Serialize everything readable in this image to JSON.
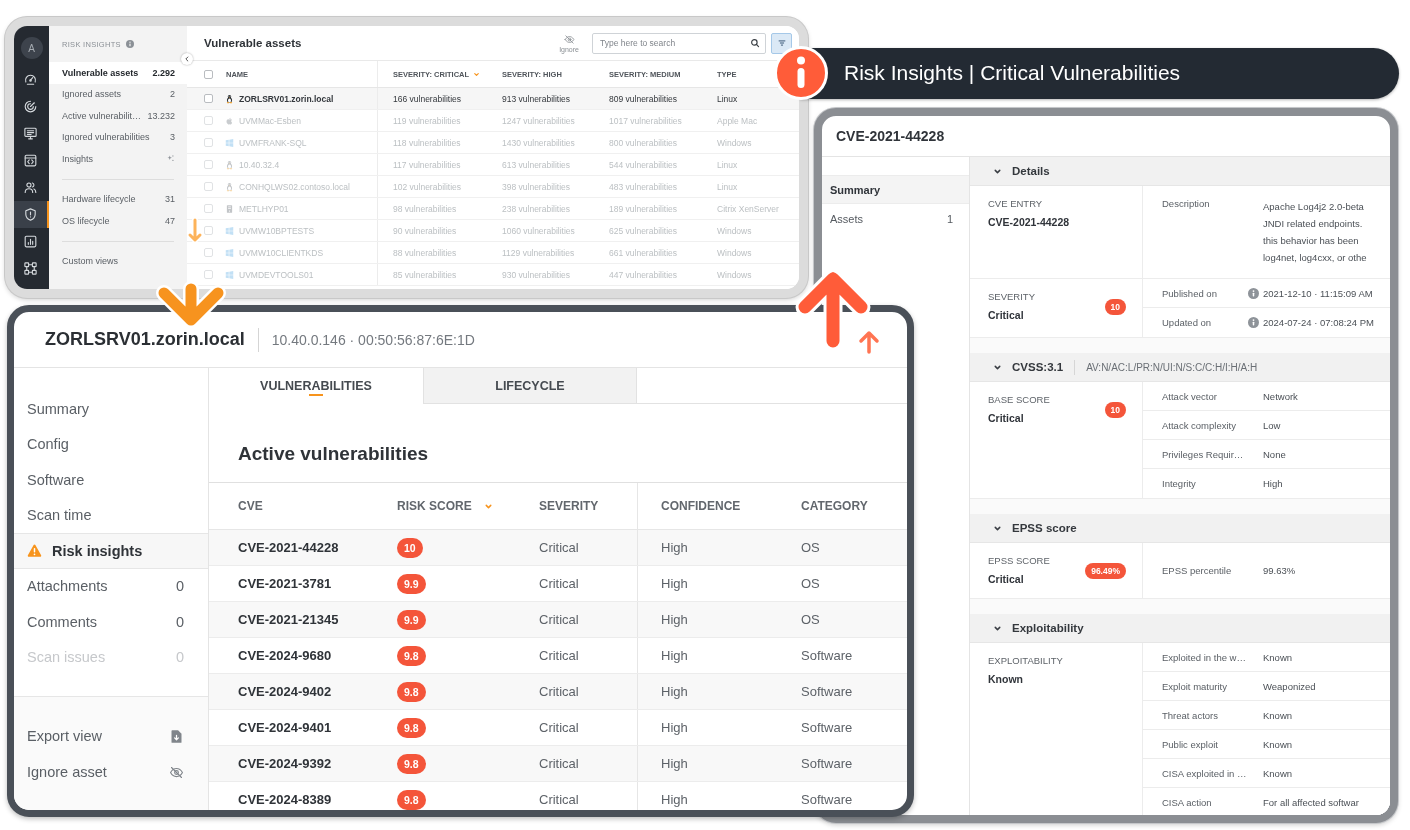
{
  "assets_window": {
    "rail": {
      "avatar": "A",
      "items": [
        {
          "selected": false
        },
        {
          "selected": false
        },
        {
          "selected": false
        },
        {
          "selected": false
        },
        {
          "selected": false
        },
        {
          "selected": true
        },
        {
          "selected": false
        },
        {
          "selected": false
        }
      ]
    },
    "sidebar": {
      "title": "RISK INSIGHTS",
      "sections": [
        {
          "items": [
            {
              "kind": "count",
              "label": "Vulnerable assets",
              "count": "2.292",
              "selected": true
            },
            {
              "kind": "count",
              "label": "Ignored assets",
              "count": "2",
              "selected": false
            },
            {
              "kind": "count",
              "label": "Active vulnerabilit…",
              "count": "13.232",
              "selected": false
            },
            {
              "kind": "count",
              "label": "Ignored vulnerabilities",
              "count": "3",
              "selected": false
            },
            {
              "kind": "indicator",
              "label": "Insights",
              "selected": false
            }
          ]
        },
        {
          "items": [
            {
              "kind": "count",
              "label": "Hardware lifecycle",
              "count": "31",
              "selected": false
            },
            {
              "kind": "count",
              "label": "OS lifecycle",
              "count": "47",
              "selected": false
            }
          ]
        },
        {
          "items": [
            {
              "kind": "link",
              "label": "Custom views",
              "selected": false
            }
          ]
        }
      ]
    },
    "title": "Vulnerable assets",
    "ignore_button": {
      "label": "Ignore",
      "disabled": true
    },
    "search": {
      "placeholder": "Type here to search"
    },
    "filter_button": {
      "on": true
    },
    "table": {
      "select_all": {
        "checked": false
      },
      "columns": [
        {
          "label": "NAME",
          "sorted": false
        },
        {
          "label": "SEVERITY: CRITICAL",
          "sorted": true
        },
        {
          "label": "SEVERITY: HIGH",
          "sorted": false
        },
        {
          "label": "SEVERITY: MEDIUM",
          "sorted": false
        },
        {
          "label": "TYPE",
          "sorted": false
        }
      ],
      "rows": [
        {
          "kind": "linux",
          "name": "ZORLSRV01.zorin.local",
          "critical": "166 vulnerabilities",
          "high": "913 vulnerabilities",
          "medium": "809 vulnerabilities",
          "type": "Linux",
          "selected": true,
          "checked": false
        },
        {
          "kind": "apple",
          "name": "UVMMac-Esben",
          "critical": "119 vulnerabilities",
          "high": "1247 vulnerabilities",
          "medium": "1017 vulnerabilities",
          "type": "Apple Mac",
          "selected": false,
          "checked": false
        },
        {
          "kind": "windows",
          "name": "UVMFRANK-SQL",
          "critical": "118 vulnerabilities",
          "high": "1430 vulnerabilities",
          "medium": "800 vulnerabilities",
          "type": "Windows",
          "selected": false,
          "checked": false
        },
        {
          "kind": "linux",
          "name": "10.40.32.4",
          "critical": "117 vulnerabilities",
          "high": "613 vulnerabilities",
          "medium": "544 vulnerabilities",
          "type": "Linux",
          "selected": false,
          "checked": false
        },
        {
          "kind": "linux",
          "name": "CONHQLWS02.contoso.local",
          "critical": "102 vulnerabilities",
          "high": "398 vulnerabilities",
          "medium": "483 vulnerabilities",
          "type": "Linux",
          "selected": false,
          "checked": false
        },
        {
          "kind": "server",
          "name": "METLHYP01",
          "critical": "98 vulnerabilities",
          "high": "238 vulnerabilities",
          "medium": "189 vulnerabilities",
          "type": "Citrix XenServer",
          "selected": false,
          "checked": false
        },
        {
          "kind": "windows",
          "name": "UVMW10BPTESTS",
          "critical": "90 vulnerabilities",
          "high": "1060 vulnerabilities",
          "medium": "625 vulnerabilities",
          "type": "Windows",
          "selected": false,
          "checked": false
        },
        {
          "kind": "windows",
          "name": "UVMW10CLIENTKDS",
          "critical": "88 vulnerabilities",
          "high": "1129 vulnerabilities",
          "medium": "661 vulnerabilities",
          "type": "Windows",
          "selected": false,
          "checked": false
        },
        {
          "kind": "windows",
          "name": "UVMDEVTOOLS01",
          "critical": "85 vulnerabilities",
          "high": "930 vulnerabilities",
          "medium": "447 vulnerabilities",
          "type": "Windows",
          "selected": false,
          "checked": false
        }
      ]
    }
  },
  "banner": {
    "title": "Risk Insights | Critical Vulnerabilities"
  },
  "cve_window": {
    "title": "CVE-2021-44228",
    "nav": [
      {
        "label": "Summary",
        "selected": true
      },
      {
        "label": "Assets",
        "count": "1",
        "selected": false
      }
    ],
    "sections": [
      {
        "title": "Details",
        "expanded": true,
        "blocks": [
          {
            "label": "CVE ENTRY",
            "value": "CVE-2021-44228",
            "rows": [
              {
                "label": "Description",
                "info": false,
                "lines": [
                  "Apache Log4j2 2.0-beta",
                  "JNDI related endpoints.",
                  "this behavior has been",
                  "log4net, log4cxx, or othe"
                ]
              }
            ]
          },
          {
            "label": "SEVERITY",
            "value": "Critical",
            "badge": "10",
            "rows": [
              {
                "label": "Published on",
                "info": true,
                "value": "2021-12-10 · 11:15:09 AM"
              },
              {
                "label": "Updated on",
                "info": true,
                "value": "2024-07-24 · 07:08:24 PM"
              }
            ]
          }
        ]
      },
      {
        "title": "CVSS:3.1",
        "vector": "AV:N/AC:L/PR:N/UI:N/S:C/C:H/I:H/A:H",
        "expanded": true,
        "blocks": [
          {
            "label": "BASE SCORE",
            "value": "Critical",
            "badge": "10",
            "rows": [
              {
                "label": "Attack vector",
                "info": false,
                "value": "Network"
              },
              {
                "label": "Attack complexity",
                "info": false,
                "value": "Low"
              },
              {
                "label": "Privileges Requir…",
                "info": false,
                "value": "None"
              },
              {
                "label": "Integrity",
                "info": false,
                "value": "High"
              }
            ]
          }
        ]
      },
      {
        "title": "EPSS score",
        "expanded": true,
        "blocks": [
          {
            "label": "EPSS SCORE",
            "value": "Critical",
            "badge": "96.49%",
            "rows": [
              {
                "label": "EPSS percentile",
                "info": false,
                "value": "99.63%"
              }
            ]
          }
        ]
      },
      {
        "title": "Exploitability",
        "expanded": true,
        "blocks": [
          {
            "label": "EXPLOITABILITY",
            "value": "Known",
            "rows": [
              {
                "label": "Exploited in the w…",
                "info": false,
                "value": "Known"
              },
              {
                "label": "Exploit maturity",
                "info": false,
                "value": "Weaponized"
              },
              {
                "label": "Threat actors",
                "info": false,
                "value": "Known"
              },
              {
                "label": "Public exploit",
                "info": false,
                "value": "Known"
              },
              {
                "label": "CISA exploited in …",
                "info": false,
                "value": "Known"
              },
              {
                "label": "CISA action",
                "info": false,
                "value": "For all affected softwar"
              }
            ]
          }
        ]
      }
    ]
  },
  "asset_window": {
    "title": "ZORLSRV01.zorin.local",
    "subtitle": "10.40.0.146 · 00:50:56:87:6E:1D",
    "nav": [
      {
        "label": "Summary",
        "selected": false,
        "disabled": false,
        "warning": false
      },
      {
        "label": "Config",
        "selected": false,
        "disabled": false,
        "warning": false
      },
      {
        "label": "Software",
        "selected": false,
        "disabled": false,
        "warning": false
      },
      {
        "label": "Scan time",
        "selected": false,
        "disabled": false,
        "warning": false
      },
      {
        "label": "Risk insights",
        "selected": true,
        "disabled": false,
        "warning": true
      },
      {
        "label": "Attachments",
        "count": "0",
        "selected": false,
        "disabled": false,
        "warning": false
      },
      {
        "label": "Comments",
        "count": "0",
        "selected": false,
        "disabled": false,
        "warning": false
      },
      {
        "label": "Scan issues",
        "count": "0",
        "selected": false,
        "disabled": true,
        "warning": false
      }
    ],
    "actions": [
      {
        "label": "Export view"
      },
      {
        "label": "Ignore asset"
      }
    ],
    "tabs": [
      {
        "label": "VULNERABILITIES",
        "selected": true
      },
      {
        "label": "LIFECYCLE",
        "selected": false
      }
    ],
    "heading": "Active vulnerabilities",
    "table": {
      "columns": [
        {
          "label": "CVE",
          "sorted": false
        },
        {
          "label": "RISK SCORE",
          "sorted": true
        },
        {
          "label": "SEVERITY",
          "sorted": false
        },
        {
          "label": "CONFIDENCE",
          "sorted": false
        },
        {
          "label": "CATEGORY",
          "sorted": false
        }
      ],
      "rows": [
        {
          "cve": "CVE-2021-44228",
          "risk_score": "10",
          "severity": "Critical",
          "confidence": "High",
          "category": "OS"
        },
        {
          "cve": "CVE-2021-3781",
          "risk_score": "9.9",
          "severity": "Critical",
          "confidence": "High",
          "category": "OS"
        },
        {
          "cve": "CVE-2021-21345",
          "risk_score": "9.9",
          "severity": "Critical",
          "confidence": "High",
          "category": "OS"
        },
        {
          "cve": "CVE-2024-9680",
          "risk_score": "9.8",
          "severity": "Critical",
          "confidence": "High",
          "category": "Software"
        },
        {
          "cve": "CVE-2024-9402",
          "risk_score": "9.8",
          "severity": "Critical",
          "confidence": "High",
          "category": "Software"
        },
        {
          "cve": "CVE-2024-9401",
          "risk_score": "9.8",
          "severity": "Critical",
          "confidence": "High",
          "category": "Software"
        },
        {
          "cve": "CVE-2024-9392",
          "risk_score": "9.8",
          "severity": "Critical",
          "confidence": "High",
          "category": "Software"
        },
        {
          "cve": "CVE-2024-8389",
          "risk_score": "9.8",
          "severity": "Critical",
          "confidence": "High",
          "category": "Software"
        }
      ]
    }
  }
}
